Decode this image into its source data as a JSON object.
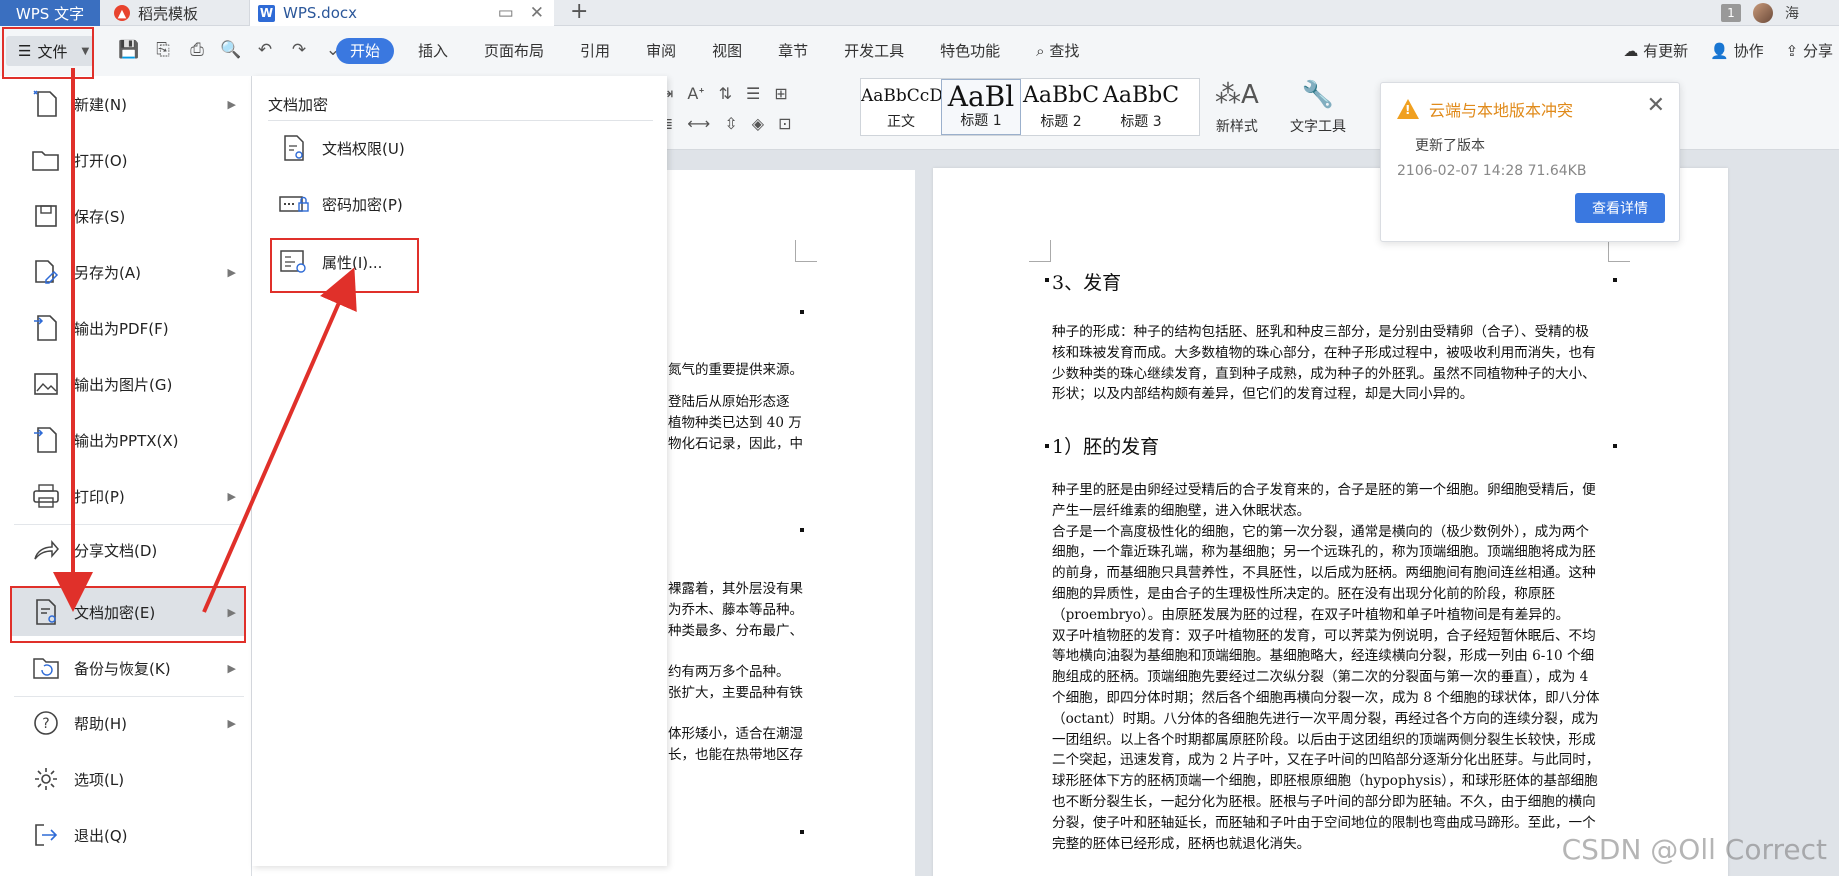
{
  "tabs": {
    "app": "WPS 文字",
    "template": "稻壳模板",
    "doc": "WPS.docx",
    "new_tab": "+"
  },
  "topright": {
    "badge": "1",
    "user": "海"
  },
  "menubar": {
    "file": "文件",
    "tabs": [
      "开始",
      "插入",
      "页面布局",
      "引用",
      "审阅",
      "视图",
      "章节",
      "开发工具",
      "特色功能",
      "查找"
    ],
    "right": [
      "有更新",
      "协作",
      "分享"
    ]
  },
  "ribbon": {
    "styles": [
      {
        "preview": "AaBbCcDd",
        "label": "正文"
      },
      {
        "preview": "AaBl",
        "label": "标题 1"
      },
      {
        "preview": "AaBbC",
        "label": "标题 2"
      },
      {
        "preview": "AaBbC",
        "label": "标题 3"
      }
    ],
    "new_style": "新样式",
    "text_tool": "文字工具"
  },
  "file_menu": [
    {
      "label": "新建(N)",
      "arrow": true
    },
    {
      "label": "打开(O)",
      "arrow": false
    },
    {
      "label": "保存(S)",
      "arrow": false
    },
    {
      "label": "另存为(A)",
      "arrow": true
    },
    {
      "label": "输出为PDF(F)",
      "arrow": false
    },
    {
      "label": "输出为图片(G)",
      "arrow": false
    },
    {
      "label": "输出为PPTX(X)",
      "arrow": false
    },
    {
      "label": "打印(P)",
      "arrow": true
    },
    {
      "label": "分享文档(D)",
      "arrow": false
    },
    {
      "label": "文档加密(E)",
      "arrow": true
    },
    {
      "label": "备份与恢复(K)",
      "arrow": true
    },
    {
      "label": "帮助(H)",
      "arrow": true
    },
    {
      "label": "选项(L)",
      "arrow": false
    },
    {
      "label": "退出(Q)",
      "arrow": false
    }
  ],
  "submenu": {
    "title": "文档加密",
    "items": [
      "文档权限(U)",
      "密码加密(P)",
      "属性(I)..."
    ]
  },
  "notification": {
    "title": "云端与本地版本冲突",
    "subtitle": "更新了版本",
    "meta": "2106-02-07 14:28 71.64KB",
    "button": "查看详情"
  },
  "left_page": {
    "lines": [
      "氮气的重要提供来源。",
      "登陆后从原始形态逐",
      "植物种类已达到 40 万",
      "物化石记录，因此，中",
      "裸露着，其外层没有果",
      "为乔木、藤本等品种。",
      "种类最多、分布最广、",
      "约有两万多个品种。",
      "张扩大，主要品种有铁",
      "体形矮小，适合在潮湿",
      "长，也能在热带地区存"
    ]
  },
  "right_page": {
    "h1": "3、发育",
    "p1": [
      "种子的形成：种子的结构包括胚、胚乳和种皮三部分，是分别由受精卵（合子）、受精的极",
      "核和珠被发育而成。大多数植物的珠心部分，在种子形成过程中，被吸收利用而消失，也有",
      "少数种类的珠心继续发育，直到种子成熟，成为种子的外胚乳。虽然不同植物种子的大小、",
      "形状；以及内部结构颇有差异，但它们的发育过程，却是大同小异的。"
    ],
    "h2": "1）胚的发育",
    "p2": [
      "种子里的胚是由卵经过受精后的合子发育来的，合子是胚的第一个细胞。卵细胞受精后，便",
      "产生一层纤维素的细胞壁，进入休眠状态。",
      "合子是一个高度极性化的细胞，它的第一次分裂，通常是横向的（极少数例外），成为两个",
      "细胞，一个靠近珠孔端，称为基细胞；另一个远珠孔的，称为顶端细胞。顶端细胞将成为胚",
      "的前身，而基细胞只具营养性，不具胚性，以后成为胚柄。两细胞间有胞间连丝相通。这种",
      "细胞的异质性，是由合子的生理极性所决定的。胚在没有出现分化前的阶段，称原胚",
      "（proembryo）。由原胚发展为胚的过程，在双子叶植物和单子叶植物间是有差异的。",
      "双子叶植物胚的发育：双子叶植物胚的发育，可以荠菜为例说明，合子经短暂休眠后、不均",
      "等地横向油裂为基细胞和顶端细胞。基细胞略大，经连续横向分裂，形成一列由 6-10 个细",
      "胞组成的胚柄。顶端细胞先要经过二次纵分裂（第二次的分裂面与第一次的垂直），成为 4",
      "个细胞，即四分体时期；然后各个细胞再横向分裂一次，成为 8 个细胞的球状体，即八分体",
      "（octant）时期。八分体的各细胞先进行一次平周分裂，再经过各个方向的连续分裂，成为",
      "一团组织。以上各个时期都属原胚阶段。以后由于这团组织的顶端两侧分裂生长较快，形成",
      "二个突起，迅速发育，成为 2 片子叶，又在子叶间的凹陷部分逐渐分化出胚芽。与此同时，",
      "球形胚体下方的胚柄顶端一个细胞，即胚根原细胞（hypophysis），和球形胚体的基部细胞",
      "也不断分裂生长，一起分化为胚根。胚根与子叶间的部分即为胚轴。不久，由于细胞的横向",
      "分裂，使子叶和胚轴延长，而胚轴和子叶由于空间地位的限制也弯曲成马蹄形。至此，一个",
      "完整的胚体已经形成，胚柄也就退化消失。"
    ]
  },
  "watermark": "CSDN @Oll Correct",
  "colors": {
    "accent": "#3a78e0",
    "annotation": "#e0302a",
    "warning": "#f0a020"
  }
}
